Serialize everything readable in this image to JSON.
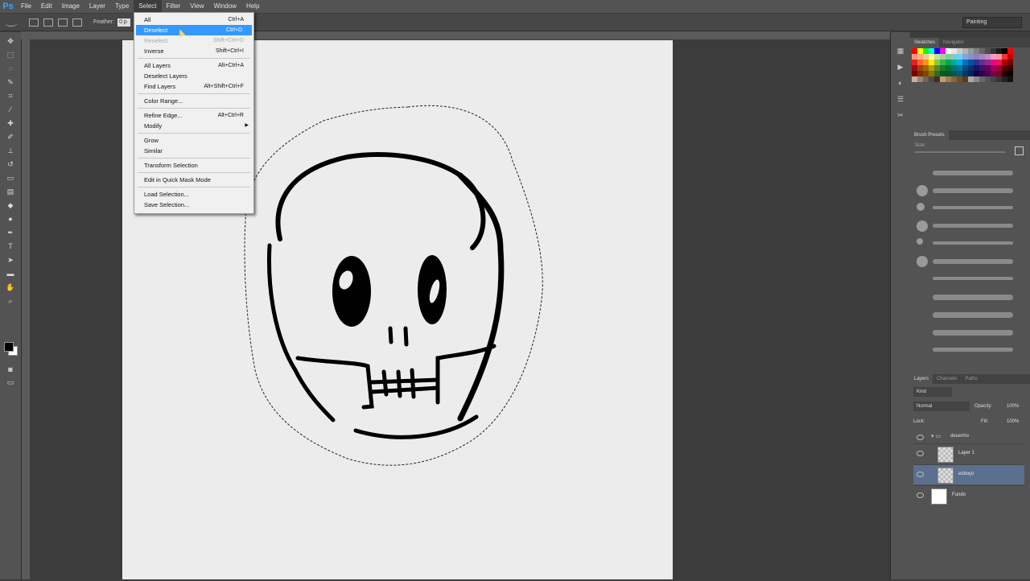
{
  "app": {
    "logo": "Ps",
    "workspace": "Painting"
  },
  "menubar": [
    {
      "label": "File"
    },
    {
      "label": "Edit"
    },
    {
      "label": "Image"
    },
    {
      "label": "Layer"
    },
    {
      "label": "Type"
    },
    {
      "label": "Select"
    },
    {
      "label": "Filter"
    },
    {
      "label": "View"
    },
    {
      "label": "Window"
    },
    {
      "label": "Help"
    }
  ],
  "options_bar": {
    "feather_label": "Feather:",
    "feather_value": "0 p"
  },
  "select_menu": {
    "groups": [
      [
        {
          "label": "All",
          "shortcut": "Ctrl+A",
          "state": "normal"
        },
        {
          "label": "Deselect",
          "shortcut": "Ctrl+D",
          "state": "highlight"
        },
        {
          "label": "Reselect",
          "shortcut": "Shift+Ctrl+D",
          "state": "disabled"
        },
        {
          "label": "Inverse",
          "shortcut": "Shift+Ctrl+I",
          "state": "normal"
        }
      ],
      [
        {
          "label": "All Layers",
          "shortcut": "Alt+Ctrl+A",
          "state": "normal"
        },
        {
          "label": "Deselect Layers",
          "shortcut": "",
          "state": "normal"
        },
        {
          "label": "Find Layers",
          "shortcut": "Alt+Shift+Ctrl+F",
          "state": "normal"
        }
      ],
      [
        {
          "label": "Color Range...",
          "shortcut": "",
          "state": "normal"
        }
      ],
      [
        {
          "label": "Refine Edge...",
          "shortcut": "Alt+Ctrl+R",
          "state": "normal"
        },
        {
          "label": "Modify",
          "shortcut": "",
          "state": "normal",
          "submenu": true
        }
      ],
      [
        {
          "label": "Grow",
          "shortcut": "",
          "state": "normal"
        },
        {
          "label": "Similar",
          "shortcut": "",
          "state": "normal"
        }
      ],
      [
        {
          "label": "Transform Selection",
          "shortcut": "",
          "state": "normal"
        }
      ],
      [
        {
          "label": "Edit in Quick Mask Mode",
          "shortcut": "",
          "state": "normal"
        }
      ],
      [
        {
          "label": "Load Selection...",
          "shortcut": "",
          "state": "normal"
        },
        {
          "label": "Save Selection...",
          "shortcut": "",
          "state": "normal"
        }
      ]
    ]
  },
  "swatches_panel": {
    "tabs": [
      "Swatches",
      "Navigator"
    ]
  },
  "brush_panel": {
    "title": "Brush Presets",
    "size_label": "Size:"
  },
  "layers_panel": {
    "tabs": [
      "Layers",
      "Channels",
      "Paths"
    ],
    "kind_label": "Kind",
    "blend_mode": "Normal",
    "opacity_label": "Opacity:",
    "opacity_value": "100%",
    "lock_label": "Lock:",
    "fill_label": "Fill:",
    "fill_value": "100%",
    "group_name": "desenho",
    "layers": [
      {
        "name": "Layer 1",
        "selected": false,
        "thumb": "transparent"
      },
      {
        "name": "esboço",
        "selected": true,
        "thumb": "transparent"
      },
      {
        "name": "Fundo",
        "selected": false,
        "thumb": "white"
      }
    ]
  },
  "colors": {
    "accent": "#3399ff",
    "foreground": "#000000",
    "background": "#ffffff"
  }
}
